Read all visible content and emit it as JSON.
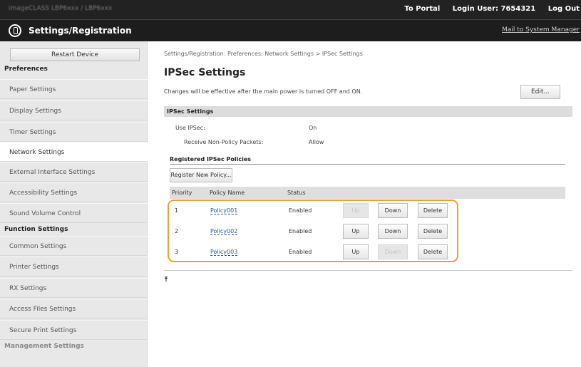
{
  "topbar": {
    "url_text": "imageCLASS LBP6xxx / LBP6xxx",
    "to_portal": "To Portal",
    "login_user_label": "Login User:",
    "login_user_value": "7654321",
    "logout": "Log Out"
  },
  "titlebar": {
    "app_title": "Settings/Registration",
    "mail_link": "Mail to System Manager",
    "logo_icon": "settings-logo-icon"
  },
  "sidebar": {
    "restart_button": "Restart Device",
    "sections": [
      {
        "heading": "Preferences",
        "items": [
          "Paper Settings",
          "Display Settings",
          "Timer Settings",
          "Network Settings",
          "External Interface Settings",
          "Accessibility Settings",
          "Sound Volume Control"
        ]
      },
      {
        "heading": "Function Settings",
        "items": [
          "Common Settings",
          "Printer Settings",
          "RX Settings",
          "Access Files Settings",
          "Secure Print Settings"
        ]
      },
      {
        "heading": "Management Settings",
        "items": []
      }
    ],
    "active_item": "Network Settings"
  },
  "main": {
    "breadcrumb": "Settings/Registration: Preferences: Network Settings > IPSec Settings",
    "page_title": "IPSec Settings",
    "notice": "Changes will be effective after the main power is turned OFF and ON.",
    "edit_button": "Edit...",
    "section_title": "IPSec Settings",
    "use_ipsec_label": "Use IPSec:",
    "use_ipsec_value": "On",
    "receive_label": "Receive Non-Policy Packets:",
    "receive_value": "Allow",
    "policies_heading": "Registered IPSec Policies",
    "register_button": "Register New Policy...",
    "table_headers": [
      "Priority",
      "Policy Name",
      "Status"
    ],
    "rows": [
      {
        "priority": "1",
        "name": "Policy001",
        "status": "Enabled",
        "up": "Up",
        "down": "Down",
        "delete": "Delete"
      },
      {
        "priority": "2",
        "name": "Policy002",
        "status": "Enabled",
        "up": "Up",
        "down": "Down",
        "delete": "Delete"
      },
      {
        "priority": "3",
        "name": "Policy003",
        "status": "Enabled",
        "up": "Up",
        "down": "Down",
        "delete": "Delete"
      }
    ],
    "top_icon": "⤒",
    "highlight_color": "#f0a030"
  }
}
